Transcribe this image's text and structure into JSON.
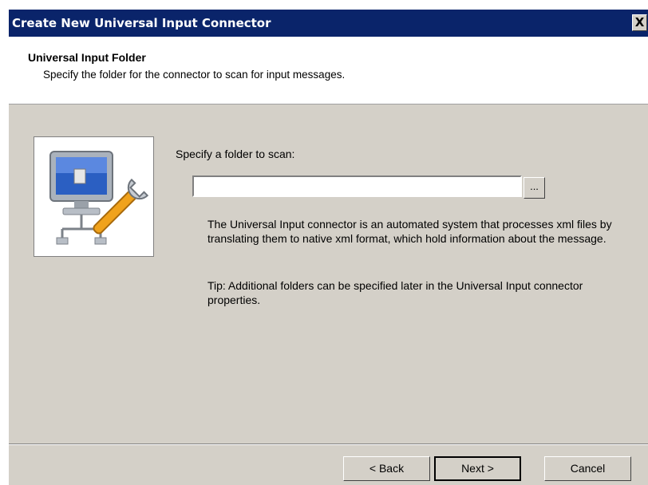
{
  "window": {
    "title": "Create New Universal Input Connector",
    "close_label": "X"
  },
  "header": {
    "title": "Universal Input Folder",
    "description": "Specify the folder for the connector to scan for input messages."
  },
  "content": {
    "image_icon": "network-computer-wrench-icon",
    "folder_label": "Specify a folder to scan:",
    "folder_value": "",
    "browse_label": "...",
    "description": "The Universal Input connector is an automated system that processes xml files by translating them to native xml format, which hold information about the message.",
    "tip": "Tip: Additional folders can be specified later in the Universal Input connector properties."
  },
  "buttons": {
    "back": "< Back",
    "next": "Next >",
    "cancel": "Cancel"
  },
  "colors": {
    "titlebar": "#0a246a",
    "dialog_face": "#d4d0c8",
    "header_bg": "#ffffff"
  }
}
